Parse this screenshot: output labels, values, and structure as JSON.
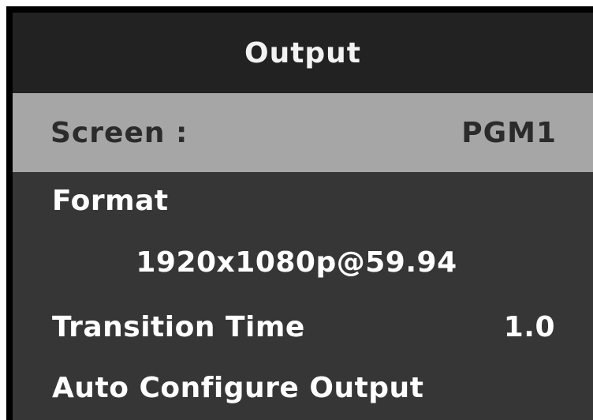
{
  "menu": {
    "title": "Output",
    "screen": {
      "label": "Screen :",
      "value": "PGM1"
    },
    "format": {
      "label": "Format",
      "value": "1920x1080p@59.94"
    },
    "transition_time": {
      "label": "Transition Time",
      "value": "1.0"
    },
    "auto_configure": {
      "label": "Auto Configure Output"
    }
  },
  "colors": {
    "panel_bg": "#363636",
    "title_bg": "#222222",
    "selected_row_bg": "#a6a6a6",
    "selected_text": "#2b2b2b",
    "text": "#ffffff"
  }
}
